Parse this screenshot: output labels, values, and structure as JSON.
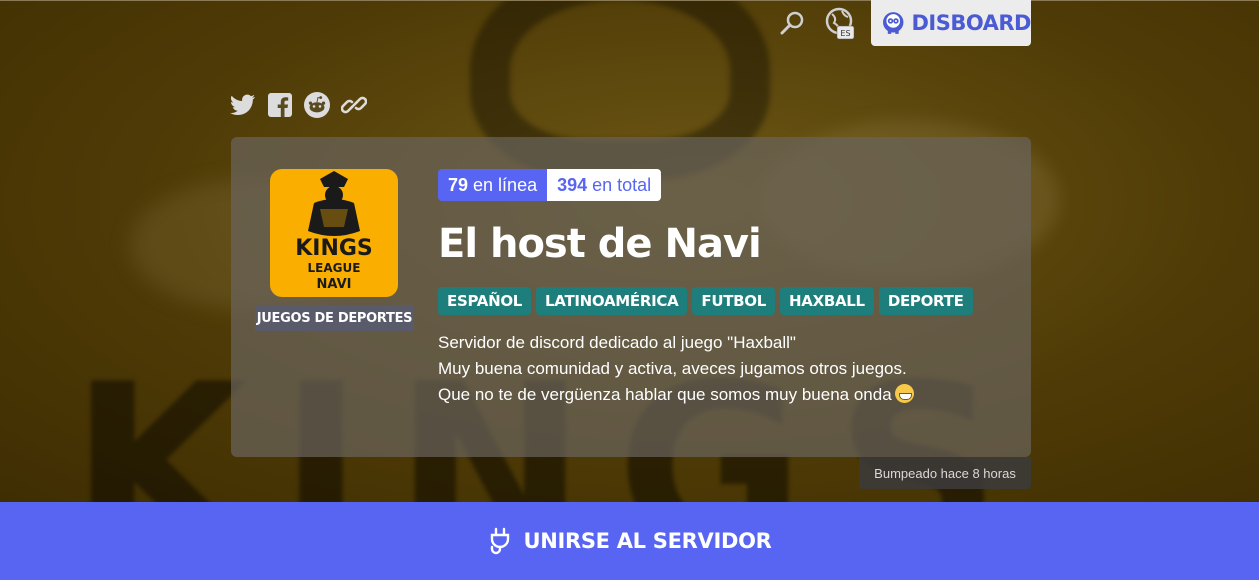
{
  "nav": {
    "search_icon": "search-icon",
    "language_icon": "globe-icon",
    "language_code": "ES",
    "brand": "DISBOARD"
  },
  "share": [
    "twitter-icon",
    "facebook-icon",
    "reddit-icon",
    "link-icon"
  ],
  "server": {
    "icon_lines": [
      "KINGS",
      "LEAGUE",
      "NAVI"
    ],
    "category": "JUEGOS DE DEPORTES",
    "online_count": "79",
    "online_label": "en línea",
    "total_count": "394",
    "total_label": "en total",
    "title": "El host de Navi",
    "tags": [
      "ESPAÑOL",
      "LATINOAMÉRICA",
      "FUTBOL",
      "HAXBALL",
      "DEPORTE"
    ],
    "description": [
      "Servidor de discord dedicado al juego \"Haxball\"",
      "Muy buena comunidad y activa, aveces jugamos otros juegos.",
      "Que no te de vergüenza hablar que somos muy buena onda"
    ],
    "bumped": "Bumpeado hace 8 horas"
  },
  "join": {
    "label": "UNIRSE AL SERVIDOR"
  },
  "colors": {
    "accent": "#5865f2",
    "tag": "#1d7e7b",
    "icon_bg": "#f9ae00"
  }
}
